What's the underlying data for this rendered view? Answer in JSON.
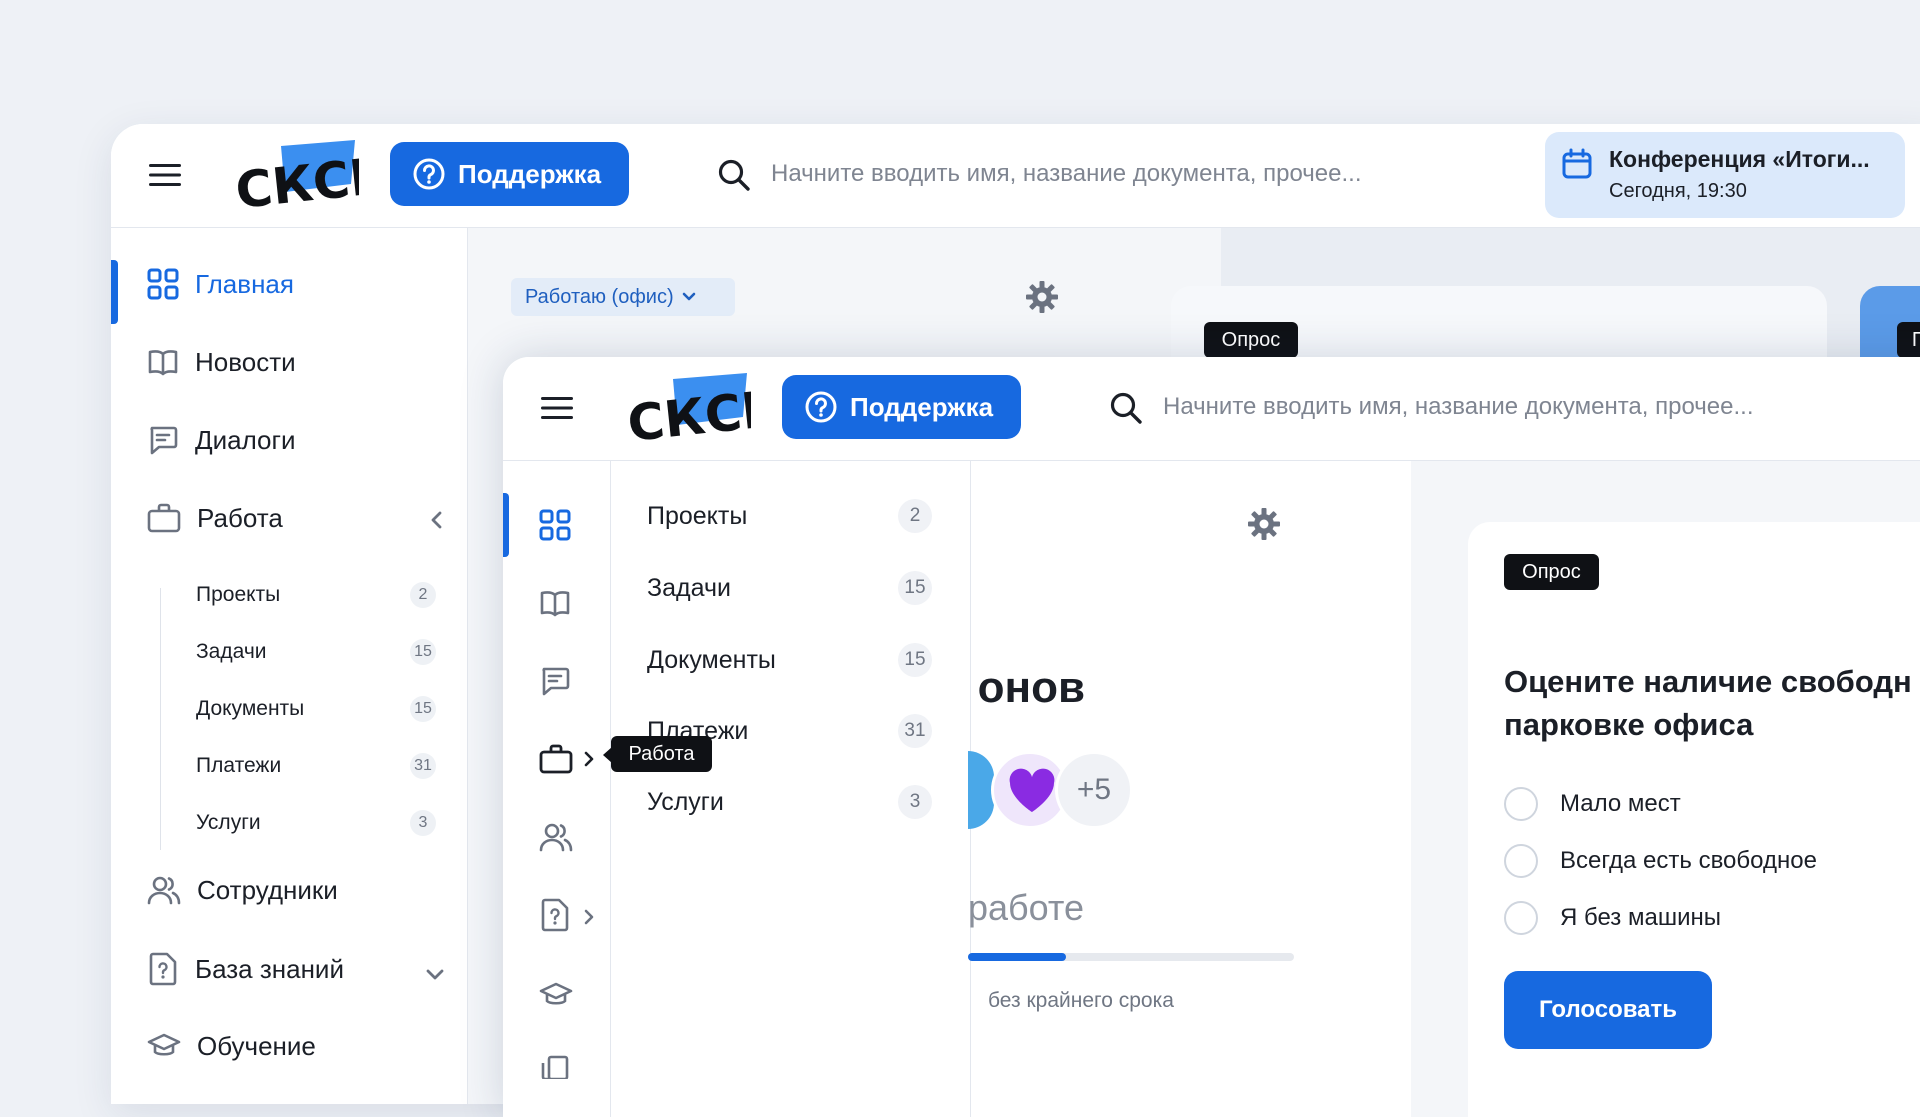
{
  "brand": {
    "logo_text": "СКСР",
    "accent": "#1769e0",
    "logo_accent": "#3b8ff0"
  },
  "header": {
    "support_label": "Поддержка",
    "search_placeholder": "Начните вводить имя, название документа, прочее...",
    "event": {
      "title": "Конференция «Итоги...",
      "time": "Сегодня, 19:30"
    }
  },
  "sidebar": {
    "items": [
      {
        "label": "Главная",
        "icon": "grid-icon",
        "active": true
      },
      {
        "label": "Новости",
        "icon": "book-icon"
      },
      {
        "label": "Диалоги",
        "icon": "chat-icon"
      },
      {
        "label": "Работа",
        "icon": "briefcase-icon"
      },
      {
        "label": "Сотрудники",
        "icon": "users-icon"
      },
      {
        "label": "База знаний",
        "icon": "doc-question-icon"
      },
      {
        "label": "Обучение",
        "icon": "graduation-cap-icon"
      }
    ],
    "work_subitems": [
      {
        "label": "Проекты",
        "count": "2"
      },
      {
        "label": "Задачи",
        "count": "15"
      },
      {
        "label": "Документы",
        "count": "15"
      },
      {
        "label": "Платежи",
        "count": "31"
      },
      {
        "label": "Услуги",
        "count": "3"
      }
    ]
  },
  "content_back": {
    "status": "Работаю (офис)",
    "poll_tag": "Опрос",
    "cut_tag": "П"
  },
  "front": {
    "tooltip": "Работа",
    "section_title_fragment": "онов",
    "more_count": "+5",
    "progress_title_fragment": "работе",
    "progress_fraction": 0.3,
    "deadline_text": "без крайнего срока",
    "poll": {
      "tag": "Опрос",
      "question_line1": "Оцените наличие свободн",
      "question_line2": "парковке офиса",
      "options": [
        "Мало мест",
        "Всегда есть свободное",
        "Я без машины"
      ],
      "vote_label": "Голосовать"
    }
  }
}
